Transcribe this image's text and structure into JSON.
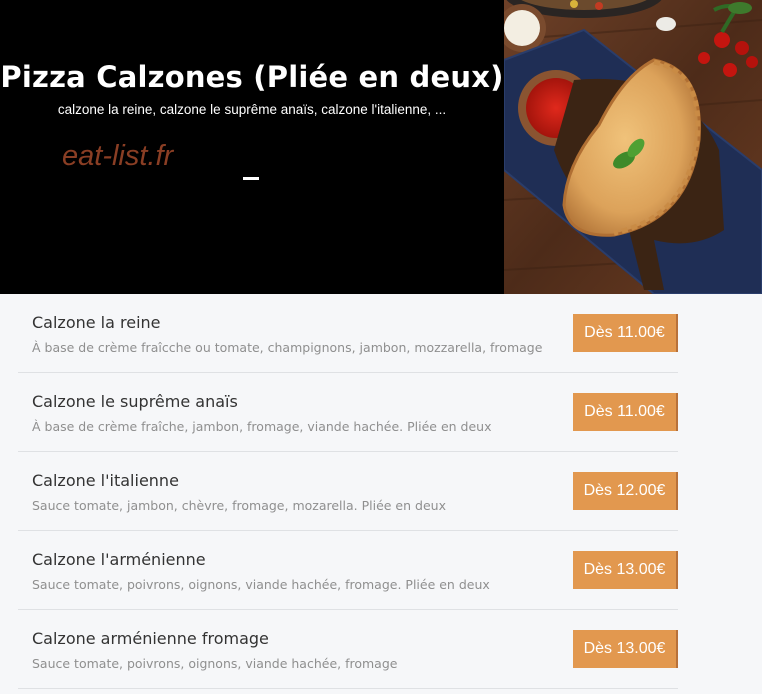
{
  "hero": {
    "title": "Pizza Calzones (Pliée en deux)",
    "subtitle": "calzone la reine, calzone le suprême anaïs, calzone l'italienne, ...",
    "brand": "eat-list.fr"
  },
  "colors": {
    "hero_bg": "#000000",
    "brand": "#8a3e24",
    "price_button": "#e2984f",
    "page_bg": "#f6f7f9"
  },
  "menu": {
    "items": [
      {
        "name": "Calzone la reine",
        "description": "À base de crème fraîcche ou tomate, champignons, jambon, mozzarella, fromage",
        "price": "Dès 11.00€"
      },
      {
        "name": "Calzone le suprême anaïs",
        "description": "À base de crème fraîche, jambon, fromage, viande hachée. Pliée en deux",
        "price": "Dès 11.00€"
      },
      {
        "name": "Calzone l'italienne",
        "description": "Sauce tomate, jambon, chèvre, fromage, mozarella. Pliée en deux",
        "price": "Dès 12.00€"
      },
      {
        "name": "Calzone l'arménienne",
        "description": "Sauce tomate, poivrons, oignons, viande hachée, fromage. Pliée en deux",
        "price": "Dès 13.00€"
      },
      {
        "name": "Calzone arménienne fromage",
        "description": "Sauce tomate, poivrons, oignons, viande hachée, fromage",
        "price": "Dès 13.00€"
      }
    ]
  }
}
